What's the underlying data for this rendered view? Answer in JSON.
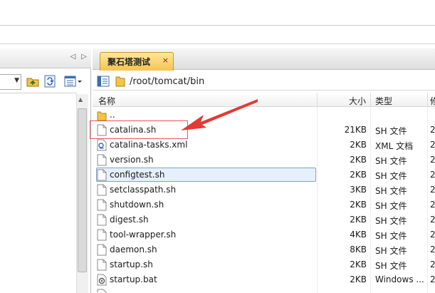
{
  "left_pane": {
    "nav_prev_icon": "◁",
    "nav_next_icon": "▷"
  },
  "tab": {
    "label": "聚石塔测试",
    "close_glyph": "×"
  },
  "path_bar": {
    "path": "/root/tomcat/bin"
  },
  "list": {
    "columns": {
      "name": "名称",
      "size": "大小",
      "type": "类型",
      "date_partial": "修"
    },
    "rows": [
      {
        "name": "..",
        "size": "",
        "type": "",
        "date": "",
        "icon": "folder-icon"
      },
      {
        "name": "catalina.sh",
        "size": "21KB",
        "type": "SH 文件",
        "date": "2",
        "icon": "file-icon"
      },
      {
        "name": "catalina-tasks.xml",
        "size": "2KB",
        "type": "XML 文档",
        "date": "2",
        "icon": "xml-file-icon"
      },
      {
        "name": "version.sh",
        "size": "2KB",
        "type": "SH 文件",
        "date": "2",
        "icon": "file-icon"
      },
      {
        "name": "configtest.sh",
        "size": "2KB",
        "type": "SH 文件",
        "date": "2",
        "icon": "file-icon",
        "selected": true
      },
      {
        "name": "setclasspath.sh",
        "size": "3KB",
        "type": "SH 文件",
        "date": "2",
        "icon": "file-icon"
      },
      {
        "name": "shutdown.sh",
        "size": "2KB",
        "type": "SH 文件",
        "date": "2",
        "icon": "file-icon"
      },
      {
        "name": "digest.sh",
        "size": "2KB",
        "type": "SH 文件",
        "date": "2",
        "icon": "file-icon"
      },
      {
        "name": "tool-wrapper.sh",
        "size": "4KB",
        "type": "SH 文件",
        "date": "2",
        "icon": "file-icon"
      },
      {
        "name": "daemon.sh",
        "size": "8KB",
        "type": "SH 文件",
        "date": "2",
        "icon": "file-icon"
      },
      {
        "name": "startup.sh",
        "size": "2KB",
        "type": "SH 文件",
        "date": "2",
        "icon": "file-icon"
      },
      {
        "name": "startup.bat",
        "size": "2KB",
        "type": "Windows ...",
        "date": "2",
        "icon": "batch-file-icon"
      }
    ]
  },
  "colors": {
    "tab_active": "#f5c452",
    "selection_border": "#7da2ce",
    "annotation": "#e53935"
  }
}
